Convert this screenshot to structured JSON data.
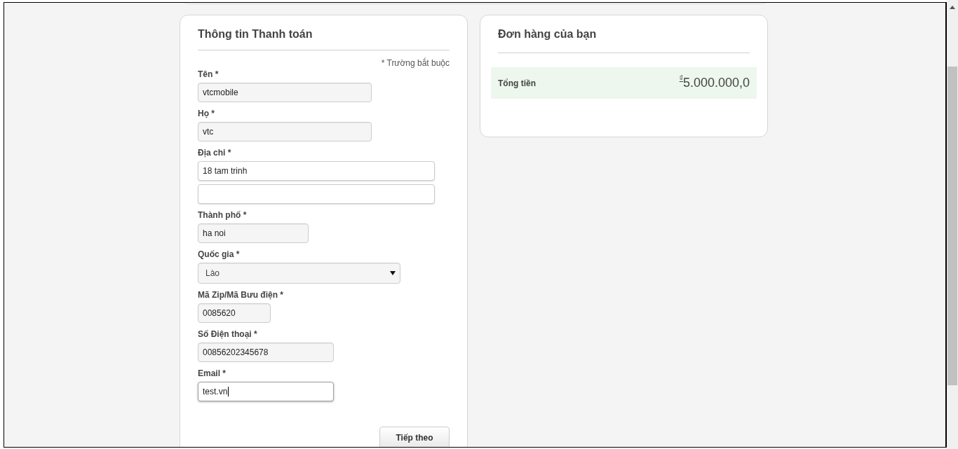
{
  "billing": {
    "title": "Thông tin Thanh toán",
    "required_note": "* Trường bắt buộc",
    "fields": [
      {
        "kind": "text",
        "label": "Tên *",
        "value": "vtcmobile",
        "focused": false
      },
      {
        "kind": "text",
        "label": "Họ *",
        "value": "vtc",
        "focused": false
      },
      {
        "kind": "address",
        "label": "Địa chỉ *",
        "value": "18 tam trinh",
        "focused": false
      },
      {
        "kind": "text",
        "label": "Thành phố *",
        "value": "ha noi",
        "focused": false
      },
      {
        "kind": "select",
        "label": "Quốc gia *",
        "value": "Lào",
        "focused": false
      },
      {
        "kind": "text",
        "label": "Mã Zip/Mã Bưu điện *",
        "value": "0085620",
        "focused": false
      },
      {
        "kind": "text",
        "label": "Số Điện thoại *",
        "value": "00856202345678",
        "focused": false
      },
      {
        "kind": "text",
        "label": "Email *",
        "value": "test.vn",
        "focused": true
      }
    ],
    "next_button": "Tiếp theo"
  },
  "order": {
    "title": "Đơn hàng của bạn",
    "total_label": "Tổng tiền",
    "currency": "₫",
    "total": "5.000.000,0"
  }
}
